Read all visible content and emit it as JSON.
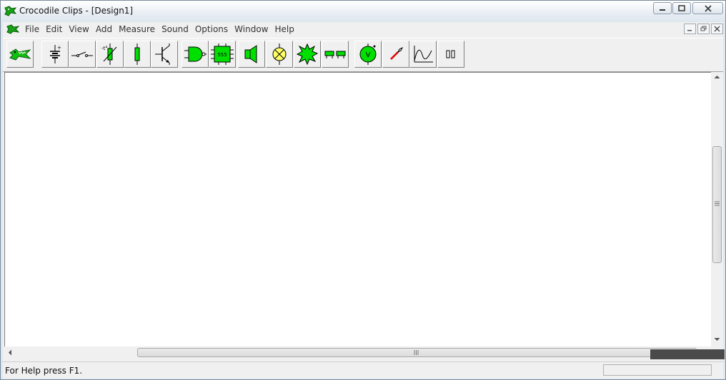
{
  "window": {
    "title": "Crocodile Clips - [Design1]"
  },
  "menu": {
    "items": [
      "File",
      "Edit",
      "View",
      "Add",
      "Measure",
      "Sound",
      "Options",
      "Window",
      "Help"
    ]
  },
  "toolbar": {
    "tools": [
      {
        "icon": "crocodile-logo-icon"
      },
      {
        "icon": "battery-icon"
      },
      {
        "icon": "switch-icon"
      },
      {
        "icon": "thermistor-icon"
      },
      {
        "icon": "resistor-icon"
      },
      {
        "icon": "transistor-icon"
      },
      {
        "icon": "logic-gate-icon"
      },
      {
        "icon": "ic-555-icon",
        "label": "555"
      },
      {
        "icon": "speaker-icon"
      },
      {
        "icon": "lamp-icon"
      },
      {
        "icon": "burst-icon"
      },
      {
        "icon": "wire-link-icon"
      },
      {
        "icon": "voltmeter-icon",
        "label": "V"
      },
      {
        "icon": "probe-icon"
      },
      {
        "icon": "graph-icon"
      },
      {
        "icon": "pause-icon"
      }
    ]
  },
  "status": {
    "text": "For Help press F1."
  },
  "colors": {
    "component_green": "#00e000",
    "lamp_yellow": "#ffff66"
  }
}
